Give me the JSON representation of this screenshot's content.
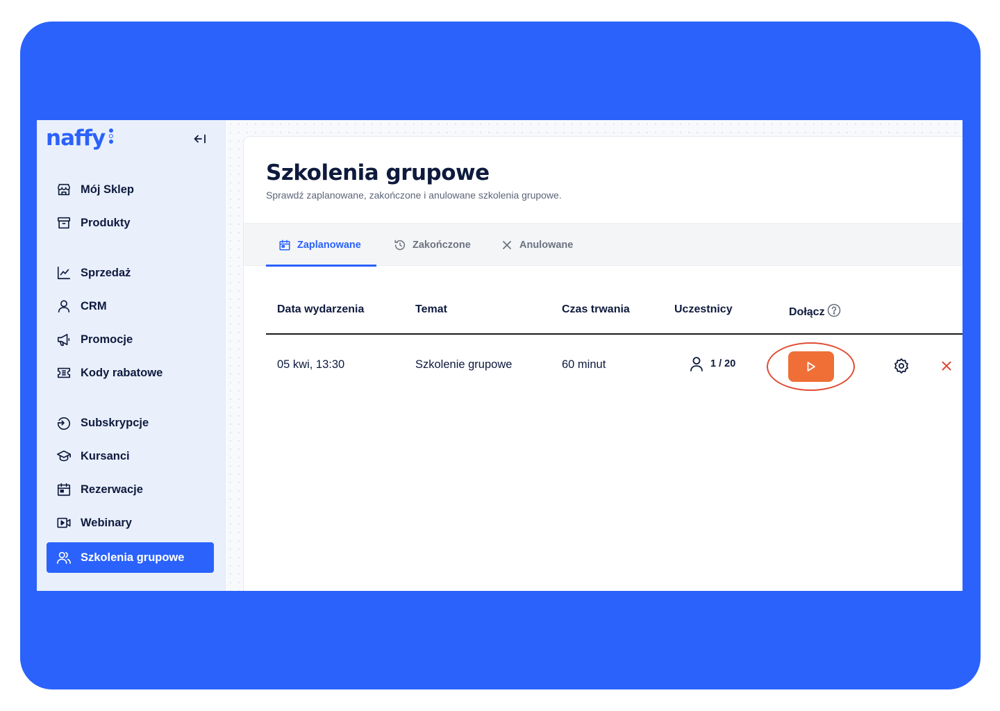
{
  "brand": {
    "name": "naffy",
    "accent": "#2a62fb",
    "join_color": "#ef6f37",
    "highlight_color": "#e04b33"
  },
  "sidebar": {
    "collapse_icon": "arrow-left-collapse-icon",
    "items": [
      {
        "label": "Mój Sklep",
        "icon": "store-icon"
      },
      {
        "label": "Produkty",
        "icon": "box-icon"
      },
      {
        "label": "Sprzedaż",
        "icon": "chart-line-icon"
      },
      {
        "label": "CRM",
        "icon": "user-icon"
      },
      {
        "label": "Promocje",
        "icon": "megaphone-icon"
      },
      {
        "label": "Kody rabatowe",
        "icon": "ticket-icon"
      },
      {
        "label": "Subskrypcje",
        "icon": "subscription-icon"
      },
      {
        "label": "Kursanci",
        "icon": "graduation-cap-icon"
      },
      {
        "label": "Rezerwacje",
        "icon": "calendar-icon"
      },
      {
        "label": "Webinary",
        "icon": "video-icon"
      },
      {
        "label": "Szkolenia grupowe",
        "icon": "users-icon",
        "active": true
      }
    ]
  },
  "page": {
    "title": "Szkolenia grupowe",
    "subtitle": "Sprawdź zaplanowane, zakończone i anulowane szkolenia grupowe."
  },
  "tabs": [
    {
      "label": "Zaplanowane",
      "icon": "calendar-icon",
      "active": true
    },
    {
      "label": "Zakończone",
      "icon": "history-icon"
    },
    {
      "label": "Anulowane",
      "icon": "close-icon"
    }
  ],
  "table": {
    "headers": [
      "Data wydarzenia",
      "Temat",
      "Czas trwania",
      "Uczestnicy",
      "Dołącz"
    ],
    "rows": [
      {
        "date": "05 kwi, 13:30",
        "topic": "Szkolenie grupowe",
        "duration": "60 minut",
        "participants": "1 / 20"
      }
    ]
  }
}
